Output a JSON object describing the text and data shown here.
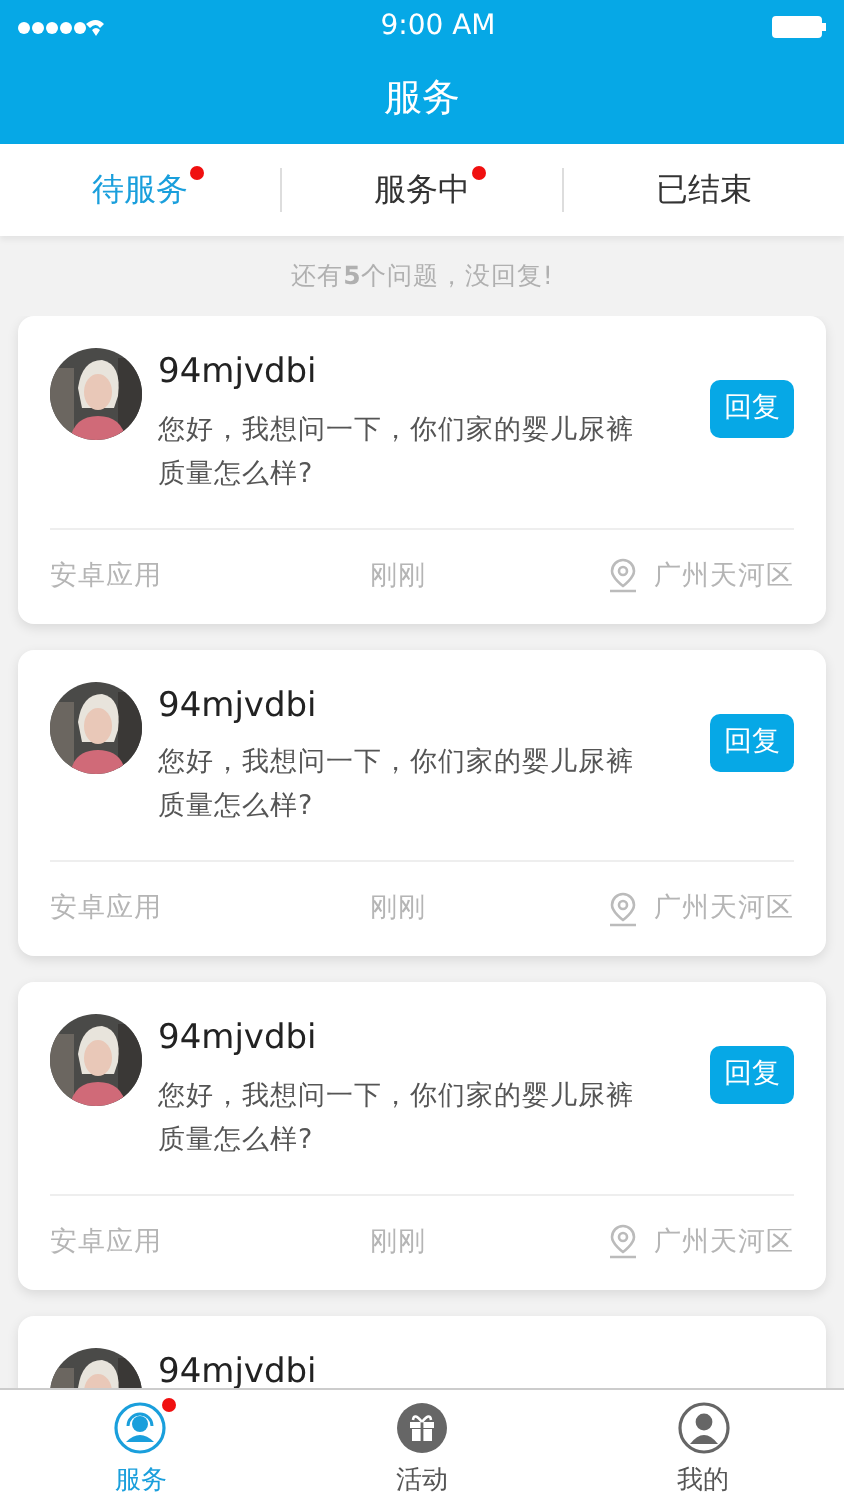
{
  "status_bar": {
    "time": "9:00 AM"
  },
  "header": {
    "title": "服务"
  },
  "tabs": [
    {
      "label": "待服务",
      "selected": true,
      "dot": true
    },
    {
      "label": "服务中",
      "selected": false,
      "dot": true
    },
    {
      "label": "已结束",
      "selected": false,
      "dot": false
    }
  ],
  "notice": "还有**5**个问题，没回复!",
  "cards": [
    {
      "name": "94mjvdbi",
      "message": "您好，我想问一下，你们家的婴儿尿裤质量怎么样?",
      "button": "回复",
      "source": "安卓应用",
      "time": "刚刚",
      "location": "广州天河区"
    },
    {
      "name": "94mjvdbi",
      "message": "您好，我想问一下，你们家的婴儿尿裤质量怎么样?",
      "button": "回复",
      "source": "安卓应用",
      "time": "刚刚",
      "location": "广州天河区"
    },
    {
      "name": "94mjvdbi",
      "message": "您好，我想问一下，你们家的婴儿尿裤质量怎么样?",
      "button": "回复",
      "source": "安卓应用",
      "time": "刚刚",
      "location": "广州天河区"
    },
    {
      "name": "94mjvdbi"
    }
  ],
  "bottom_nav": [
    {
      "label": "服务",
      "kind": "headset",
      "selected": true,
      "dot": true
    },
    {
      "label": "活动",
      "kind": "gift",
      "selected": false,
      "dot": false
    },
    {
      "label": "我的",
      "kind": "person",
      "selected": false,
      "dot": false
    }
  ]
}
